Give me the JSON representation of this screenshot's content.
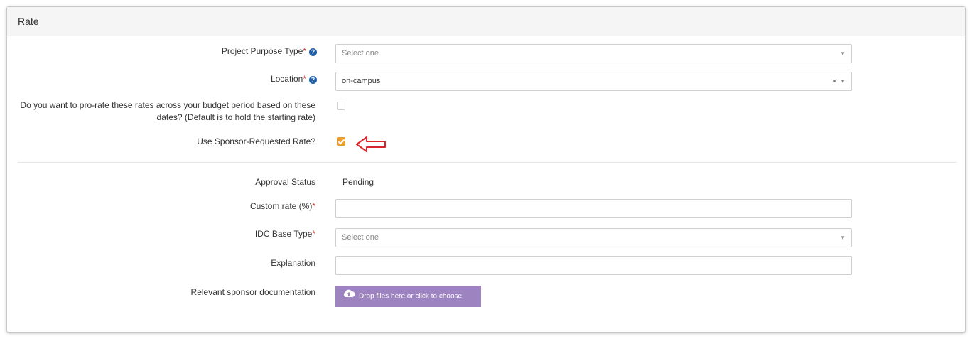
{
  "panel": {
    "title": "Rate"
  },
  "project_purpose": {
    "label": "Project Purpose Type",
    "required_mark": "*",
    "placeholder": "Select one"
  },
  "location": {
    "label": "Location",
    "required_mark": "*",
    "value": "on-campus",
    "clear_glyph": "×"
  },
  "prorate": {
    "label": "Do you want to pro-rate these rates across your budget period based on these dates? (Default is to hold the starting rate)",
    "checked": false
  },
  "sponsor_rate": {
    "label": "Use Sponsor-Requested Rate?",
    "checked": true
  },
  "approval": {
    "label": "Approval Status",
    "value": "Pending"
  },
  "custom_rate": {
    "label": "Custom rate (%)",
    "required_mark": "*",
    "value": ""
  },
  "idc_base": {
    "label": "IDC Base Type",
    "required_mark": "*",
    "placeholder": "Select one"
  },
  "explanation": {
    "label": "Explanation",
    "value": ""
  },
  "documentation": {
    "label": "Relevant sponsor documentation",
    "button_label": "Drop files here or click to choose"
  },
  "icons": {
    "help": "question-circle-icon",
    "caret": "caret-down-icon",
    "upload": "cloud-upload-icon",
    "annotation": "red-arrow-icon"
  },
  "colors": {
    "checkbox_checked": "#f0a030",
    "upload_button": "#9d83c0",
    "help_icon": "#1f5fa8",
    "required": "#c0392b",
    "annotation_arrow": "#d9262b"
  }
}
